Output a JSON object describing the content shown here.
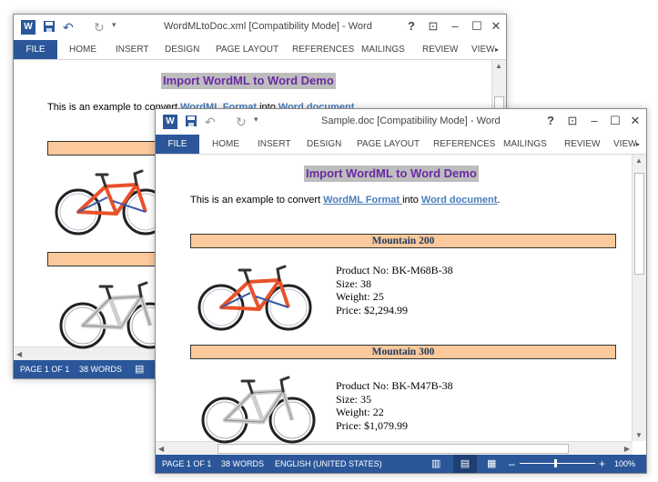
{
  "back_window": {
    "title": "WordMLtoDoc.xml [Compatibility Mode] - Word",
    "tabs": [
      "FILE",
      "HOME",
      "INSERT",
      "DESIGN",
      "PAGE LAYOUT",
      "REFERENCES",
      "MAILINGS",
      "REVIEW",
      "VIEW"
    ],
    "doc_title": "Import WordML to Word Demo",
    "intro_prefix": "This is an example to convert ",
    "intro_link1": "WordML Format ",
    "intro_mid": "into ",
    "intro_link2": "Word document",
    "status": {
      "page": "PAGE 1 OF 1",
      "words": "38 WORDS"
    }
  },
  "front_window": {
    "title": "Sample.doc [Compatibility Mode] - Word",
    "tabs": [
      "FILE",
      "HOME",
      "INSERT",
      "DESIGN",
      "PAGE LAYOUT",
      "REFERENCES",
      "MAILINGS",
      "REVIEW",
      "VIEW"
    ],
    "doc_title": "Import WordML to Word Demo",
    "intro_prefix": "This is an example to convert ",
    "intro_link1": "WordML Format ",
    "intro_mid": "into ",
    "intro_link2": "Word document",
    "intro_suffix": ".",
    "products": [
      {
        "name": "Mountain 200",
        "product_no": "Product No: BK-M68B-38",
        "size": "Size: 38",
        "weight": "Weight: 25",
        "price": "Price: $2,294.99"
      },
      {
        "name": "Mountain 300",
        "product_no": "Product No: BK-M47B-38",
        "size": "Size: 35",
        "weight": "Weight: 22",
        "price": "Price: $1,079.99"
      }
    ],
    "status": {
      "page": "PAGE 1 OF 1",
      "words": "38 WORDS",
      "language": "ENGLISH (UNITED STATES)",
      "zoom": "100%"
    }
  },
  "colors": {
    "accent": "#2b579a",
    "band": "#fbc99b",
    "title_text": "#6a2aa3",
    "link": "#4a7ebb",
    "bike_red_frame": "#e8512a"
  },
  "icons": [
    "word-logo-icon",
    "save-icon",
    "undo-icon",
    "redo-icon",
    "customize-icon",
    "help-icon",
    "ribbon-display-icon",
    "minimize-icon",
    "maximize-icon",
    "close-icon",
    "read-mode-icon",
    "print-layout-icon",
    "web-layout-icon"
  ]
}
